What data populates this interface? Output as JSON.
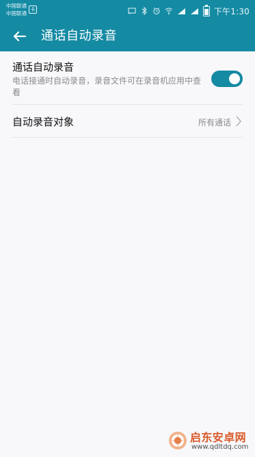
{
  "status_bar": {
    "carrier_1": "中国联通",
    "carrier_2": "中国联通",
    "sim_label": "卡",
    "time": "下午1:30",
    "icons": [
      "cast-icon",
      "bluetooth-icon",
      "alarm-icon",
      "wifi-icon",
      "signal-icon",
      "signal-icon",
      "battery-icon"
    ]
  },
  "app_bar": {
    "back_icon": "back-arrow-icon",
    "title": "通话自动录音"
  },
  "settings": {
    "auto_record": {
      "title": "通话自动录音",
      "description": "电话接通时自动录音，录音文件可在录音机应用中查看",
      "enabled": true
    },
    "record_target": {
      "label": "自动录音对象",
      "value": "所有通话",
      "icon": "chevron-right-icon"
    }
  },
  "watermark": {
    "title": "启东安卓网",
    "url": "www.qdltdq.com"
  },
  "colors": {
    "accent": "#158aa3",
    "background": "#f8f8fb",
    "watermark": "#d85a2a"
  }
}
